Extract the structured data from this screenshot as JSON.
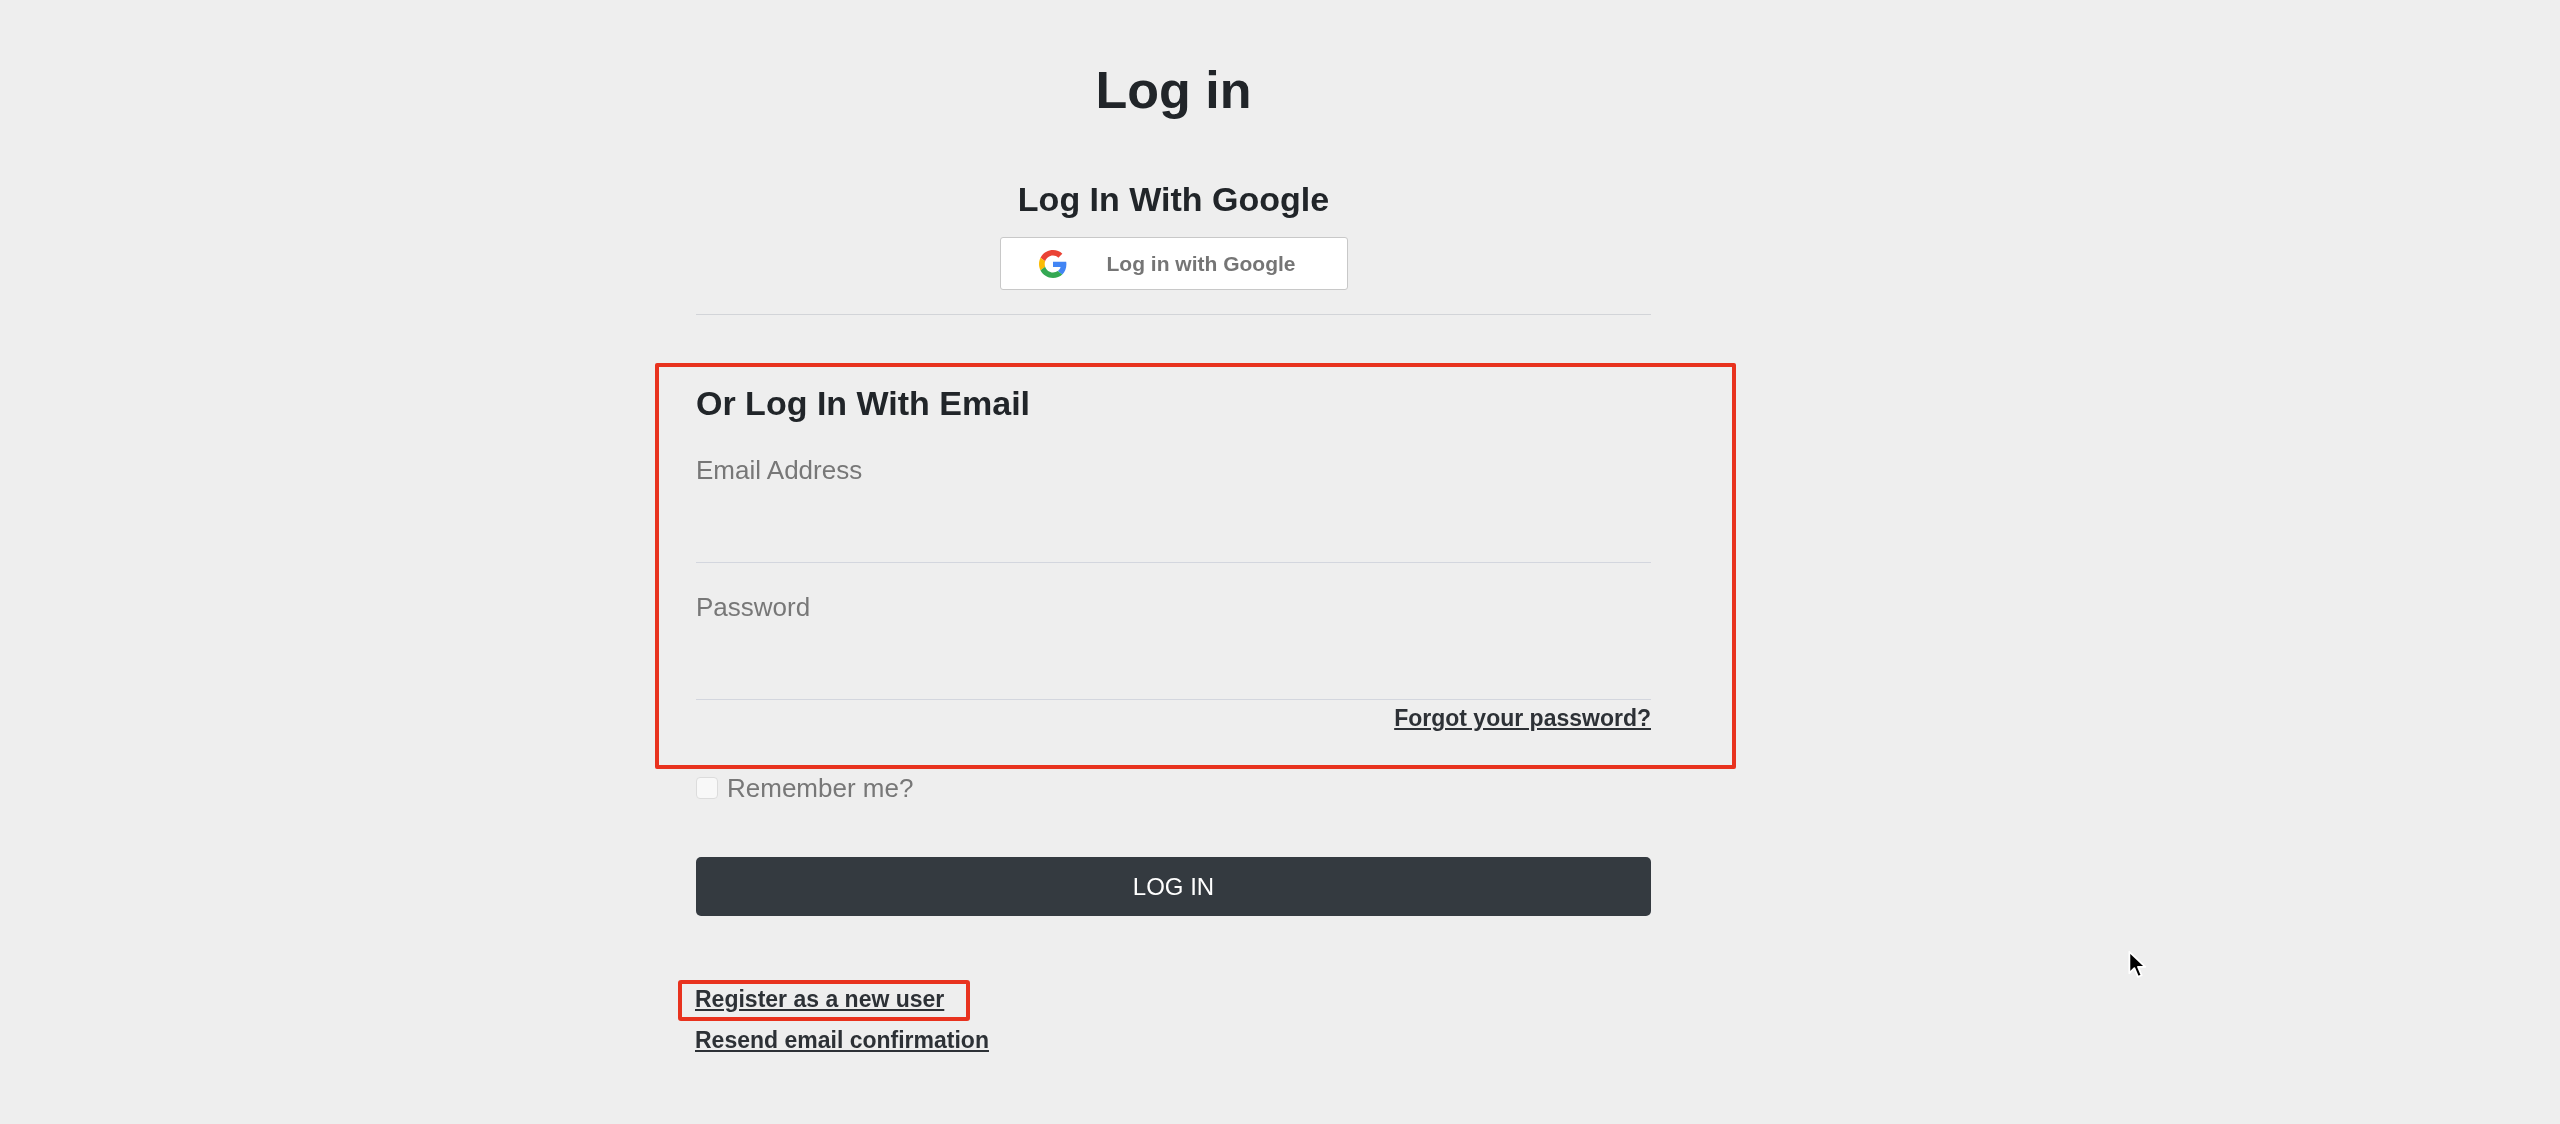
{
  "page": {
    "title": "Log in"
  },
  "google": {
    "heading": "Log In With Google",
    "button": "Log in with Google"
  },
  "email_section": {
    "heading": "Or Log In With Email",
    "highlighted": true,
    "fields": [
      {
        "label": "Email Address"
      },
      {
        "label": "Password"
      }
    ],
    "forgot_link": "Forgot your password?"
  },
  "remember": {
    "label": "Remember me?",
    "checked": false
  },
  "submit_button": "LOG IN",
  "links": [
    {
      "label": "Register as a new user",
      "highlighted": true
    },
    {
      "label": "Resend email confirmation",
      "highlighted": false
    }
  ]
}
